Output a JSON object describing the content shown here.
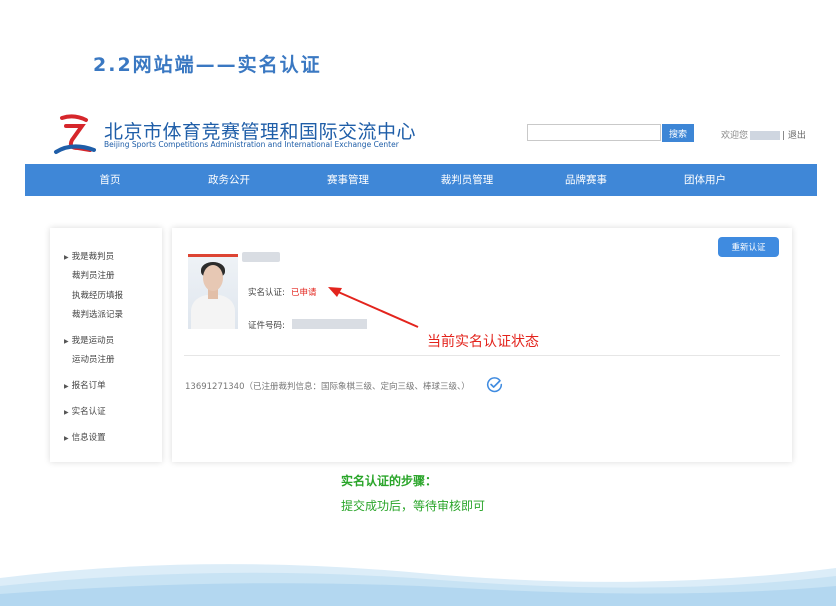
{
  "slide": {
    "title": "2.2网站端——实名认证"
  },
  "header": {
    "title_cn": "北京市体育竞赛管理和国际交流中心",
    "title_en": "Beijing Sports Competitions Administration and International Exchange Center",
    "search_placeholder": "",
    "search_button": "搜索",
    "welcome_prefix": "欢迎您",
    "logout": "| 退出"
  },
  "nav": {
    "items": [
      "首页",
      "政务公开",
      "赛事管理",
      "裁判员管理",
      "品牌赛事",
      "团体用户"
    ]
  },
  "sidebar": {
    "g1": "我是裁判员",
    "g1_items": [
      "裁判员注册",
      "执裁经历填报",
      "裁判选派记录"
    ],
    "g2": "我是运动员",
    "g2_items": [
      "运动员注册"
    ],
    "g3": "报名订单",
    "g4": "实名认证",
    "g5": "信息设置"
  },
  "profile": {
    "cert_label": "实名认证:",
    "cert_status": "已申请",
    "id_label": "证件号码:",
    "reauth_button": "重新认证",
    "phone_info": "13691271340（已注册裁判信息：国际象棋三级、定向三级、棒球三级、）"
  },
  "annotation": {
    "text": "当前实名认证状态"
  },
  "steps": {
    "title": "实名认证的步骤：",
    "text": "提交成功后，等待审核即可"
  },
  "colors": {
    "brand_blue": "#3f87d7",
    "status_red": "#e3241d",
    "step_green": "#2aa52a"
  }
}
